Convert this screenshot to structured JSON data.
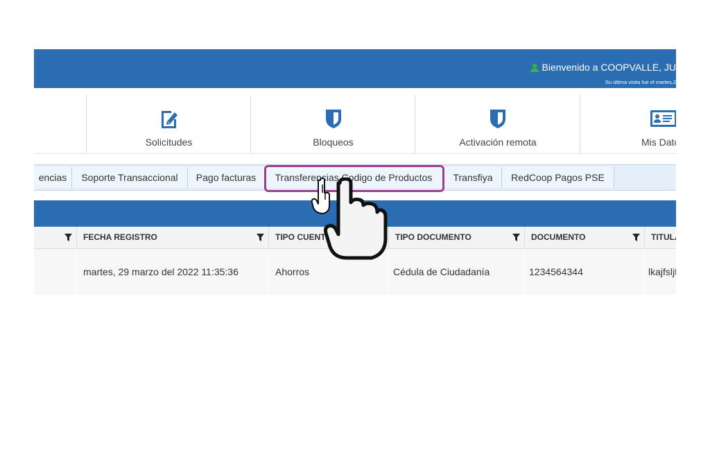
{
  "header": {
    "welcome": "Bienvenido a COOPVALLE, JU",
    "last_visit": "Su última visita fue el martes,2"
  },
  "menu": [
    {
      "label": "Solicitudes",
      "icon": "edit-document-icon"
    },
    {
      "label": "Bloqueos",
      "icon": "shield-icon"
    },
    {
      "label": "Activación remota",
      "icon": "shield-icon"
    },
    {
      "label": "Mis Datc",
      "icon": "id-card-icon"
    }
  ],
  "tabs": [
    "encias",
    "Soporte Transaccional",
    "Pago facturas",
    "Transferencias Codigo de Productos",
    "Transfiya",
    "RedCoop Pagos PSE"
  ],
  "columns": [
    "FECHA REGISTRO",
    "TIPO CUENT",
    "TIPO DOCUMENTO",
    "DOCUMENTO",
    "TITULA"
  ],
  "row": {
    "fecha": "martes, 29 marzo del 2022 11:35:36",
    "tipo_cuenta": "Ahorros",
    "tipo_documento": "Cédula de Ciudadanía",
    "documento": "1234564344",
    "titular": "lkajfsljt"
  },
  "colors": {
    "header_blue": "#2a6db3",
    "highlight": "#9c3d8e",
    "user_icon_green": "#3cb043"
  }
}
